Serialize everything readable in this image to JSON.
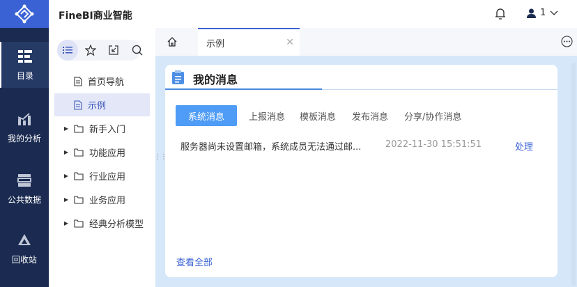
{
  "app": {
    "title": "FineBI商业智能"
  },
  "user": {
    "name": "1"
  },
  "nav": [
    {
      "label": "目录"
    },
    {
      "label": "我的分析"
    },
    {
      "label": "公共数据"
    },
    {
      "label": "回收站"
    }
  ],
  "directory": {
    "items": [
      {
        "label": "首页导航",
        "type": "file"
      },
      {
        "label": "示例",
        "type": "file"
      },
      {
        "label": "新手入门",
        "type": "folder"
      },
      {
        "label": "功能应用",
        "type": "folder"
      },
      {
        "label": "行业应用",
        "type": "folder"
      },
      {
        "label": "业务应用",
        "type": "folder"
      },
      {
        "label": "经典分析模型",
        "type": "folder"
      }
    ]
  },
  "tabs": [
    {
      "label": "示例"
    }
  ],
  "card": {
    "title": "我的消息",
    "tabs": [
      {
        "label": "系统消息"
      },
      {
        "label": "上报消息"
      },
      {
        "label": "模板消息"
      },
      {
        "label": "发布消息"
      },
      {
        "label": "分享/协作消息"
      }
    ],
    "messages": [
      {
        "text": "服务器尚未设置邮箱，系统成员无法通过邮...",
        "time": "2022-11-30 15:51:51",
        "action": "处理"
      }
    ],
    "view_all": "查看全部"
  },
  "colors": {
    "accent": "#3a62d5",
    "nav_bg": "#1a2a50",
    "active_tab": "#4e9cf5"
  }
}
